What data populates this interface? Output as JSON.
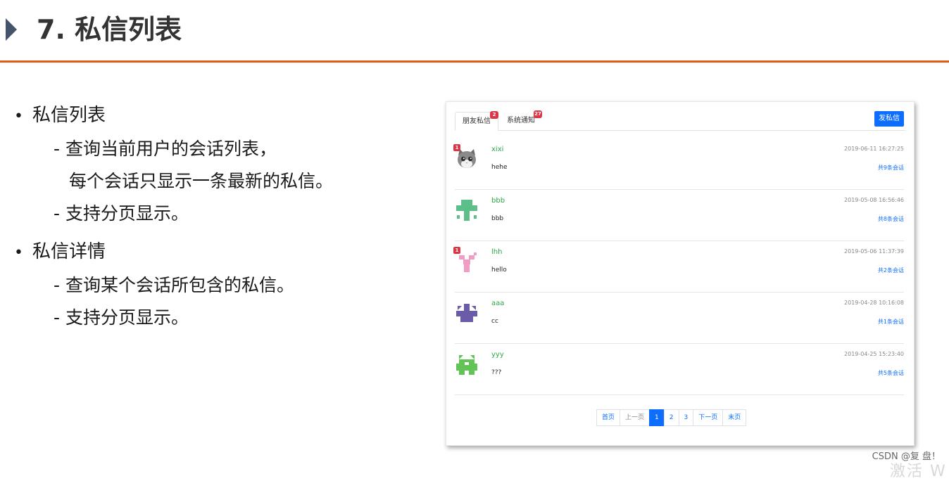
{
  "slide": {
    "title": "7. 私信列表",
    "bullets": [
      {
        "label": "私信列表",
        "subs": [
          "- 查询当前用户的会话列表，",
          "每个会话只显示一条最新的私信。",
          "- 支持分页显示。"
        ]
      },
      {
        "label": "私信详情",
        "subs": [
          "- 查询某个会话所包含的私信。",
          "- 支持分页显示。"
        ]
      }
    ]
  },
  "screenshot": {
    "tabs": [
      {
        "label": "朋友私信",
        "badge": "2",
        "active": true
      },
      {
        "label": "系统通知",
        "badge": "27",
        "active": false
      }
    ],
    "send_button": "发私信",
    "conversations": [
      {
        "user": "xixi",
        "text": "hehe",
        "time": "2019-06-11 16:27:25",
        "count": "共9条会话",
        "unread": "1",
        "avatar": "cat-avatar-icon"
      },
      {
        "user": "bbb",
        "text": "bbb",
        "time": "2019-05-08 16:56:46",
        "count": "共8条会话",
        "unread": "",
        "avatar": "green-identicon"
      },
      {
        "user": "lhh",
        "text": "hello",
        "time": "2019-05-06 11:37:39",
        "count": "共2条会话",
        "unread": "1",
        "avatar": "pink-identicon"
      },
      {
        "user": "aaa",
        "text": "cc",
        "time": "2019-04-28 10:16:08",
        "count": "共1条会话",
        "unread": "",
        "avatar": "purple-identicon"
      },
      {
        "user": "yyy",
        "text": "???",
        "time": "2019-04-25 15:23:40",
        "count": "共5条会话",
        "unread": "",
        "avatar": "lime-identicon"
      }
    ],
    "pagination": [
      "首页",
      "上一页",
      "1",
      "2",
      "3",
      "下一页",
      "末页"
    ],
    "active_page": "1"
  },
  "watermark": "CSDN @复 盘！",
  "corner_text": "激活 W",
  "colors": {
    "accent_rule": "#e45a17",
    "primary": "#0d6efd",
    "badge": "#dc3545",
    "username": "#28a745"
  }
}
